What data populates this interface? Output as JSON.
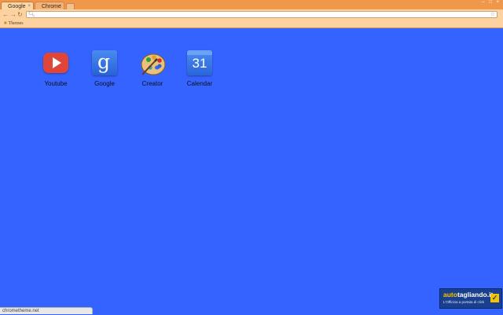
{
  "tabs": [
    {
      "title": "Google",
      "close": "×",
      "active": true
    },
    {
      "title": "Chrome",
      "close": "×",
      "active": false
    }
  ],
  "window_controls": "– □ ×",
  "toolbar": {
    "back_glyph": "←",
    "forward_glyph": "→",
    "reload_glyph": "↻",
    "omnibox_value": "",
    "search_icon": "search-icon",
    "star_icon": "star-icon"
  },
  "bookmarks": [
    {
      "label": "Themes",
      "icon": "folder-icon"
    }
  ],
  "apps": [
    {
      "label": "Youtube",
      "icon": "youtube-icon"
    },
    {
      "label": "Google",
      "icon": "google-icon",
      "glyph": "g"
    },
    {
      "label": "Creator",
      "icon": "palette-icon"
    },
    {
      "label": "Calendar",
      "icon": "calendar-icon",
      "glyph": "31"
    }
  ],
  "status_text": "chrometheme.net",
  "ad": {
    "brand_highlight": "auto",
    "brand_rest": "tagliando.it",
    "tagline": "L'Officina a portata di click",
    "check": "✓"
  },
  "colors": {
    "background": "#3563ff",
    "frame": "#f0974a",
    "toolbar": "#fbd2a0"
  }
}
